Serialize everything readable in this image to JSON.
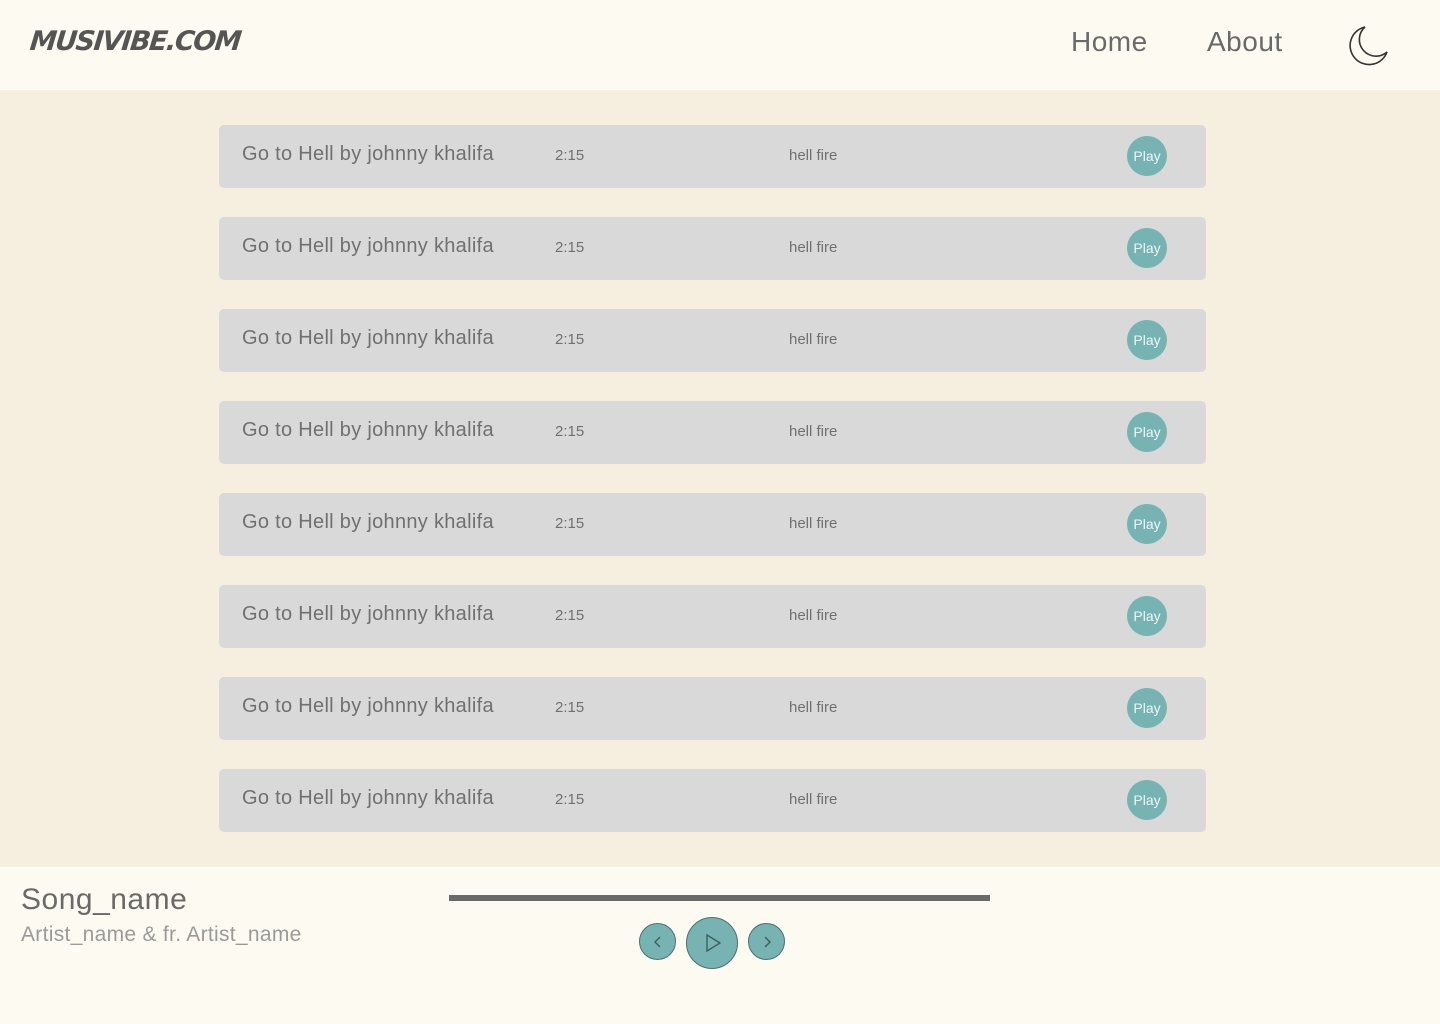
{
  "header": {
    "logo": "MUSIVIBE.COM",
    "nav": [
      {
        "label": "Home"
      },
      {
        "label": "About"
      }
    ],
    "theme_icon": "moon-icon"
  },
  "songs": [
    {
      "title": "Go to Hell by johnny khalifa",
      "duration": "2:15",
      "genre": "hell fire",
      "play_label": "Play"
    },
    {
      "title": "Go to Hell by johnny khalifa",
      "duration": "2:15",
      "genre": "hell fire",
      "play_label": "Play"
    },
    {
      "title": "Go to Hell by johnny khalifa",
      "duration": "2:15",
      "genre": "hell fire",
      "play_label": "Play"
    },
    {
      "title": "Go to Hell by johnny khalifa",
      "duration": "2:15",
      "genre": "hell fire",
      "play_label": "Play"
    },
    {
      "title": "Go to Hell by johnny khalifa",
      "duration": "2:15",
      "genre": "hell fire",
      "play_label": "Play"
    },
    {
      "title": "Go to Hell by johnny khalifa",
      "duration": "2:15",
      "genre": "hell fire",
      "play_label": "Play"
    },
    {
      "title": "Go to Hell by johnny khalifa",
      "duration": "2:15",
      "genre": "hell fire",
      "play_label": "Play"
    },
    {
      "title": "Go to Hell by johnny khalifa",
      "duration": "2:15",
      "genre": "hell fire",
      "play_label": "Play"
    }
  ],
  "player": {
    "song_name": "Song_name",
    "artist": "Artist_name & fr. Artist_name",
    "progress": 1.0,
    "icons": {
      "prev": "chevron-left-icon",
      "play": "play-icon",
      "next": "chevron-right-icon"
    }
  },
  "colors": {
    "accent": "#76b3b2",
    "page_bg": "#f6efdf",
    "bar_bg": "#fdfaf2",
    "row_bg": "#d9d9d9"
  }
}
